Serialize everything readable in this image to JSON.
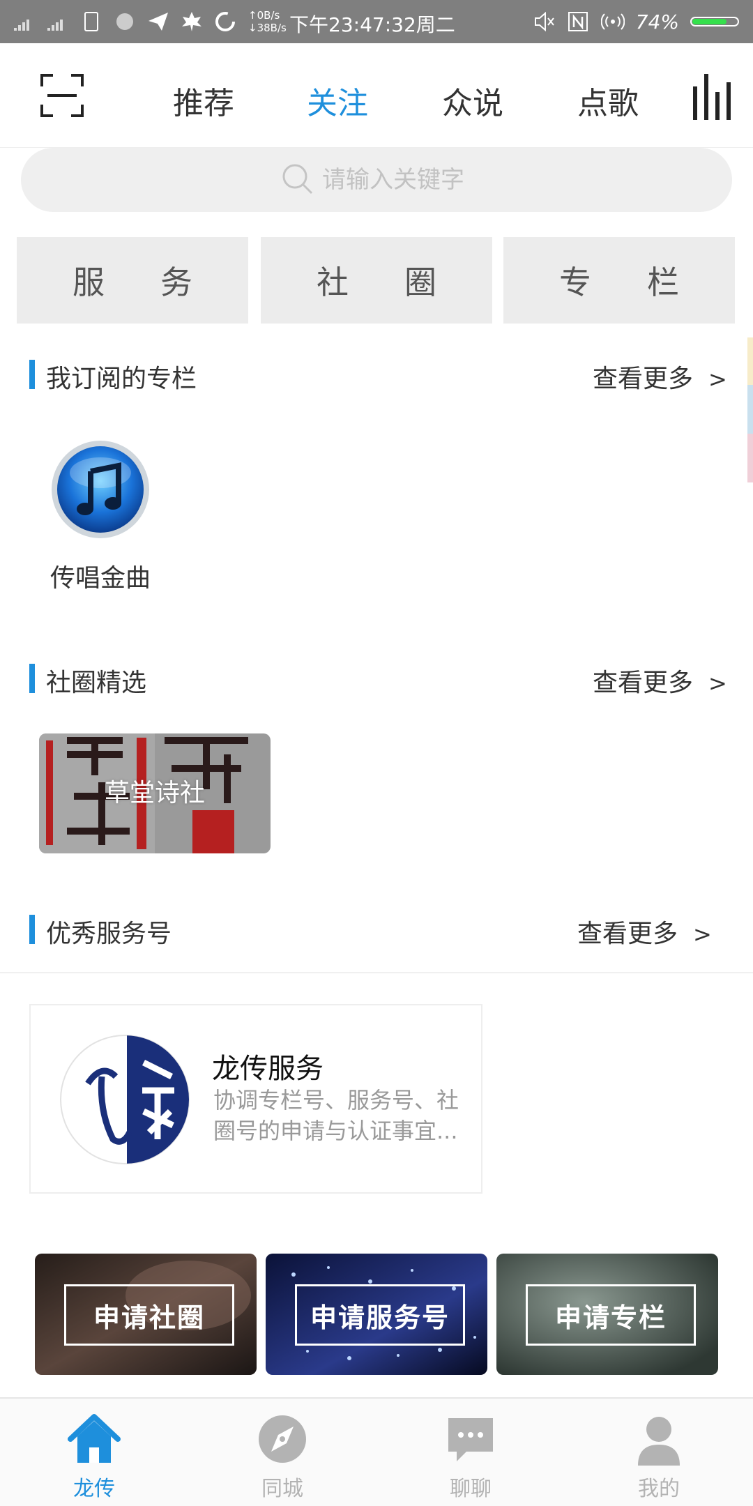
{
  "status_bar": {
    "net_up": "↑0B/s",
    "net_down": "↓38B/s",
    "time": "下午23:47:32周二",
    "battery": "74%",
    "battery_level": 0.74
  },
  "top_nav": {
    "tabs": [
      {
        "label": "推荐",
        "active": false
      },
      {
        "label": "关注",
        "active": true
      },
      {
        "label": "众说",
        "active": false
      },
      {
        "label": "点歌",
        "active": false
      }
    ]
  },
  "search": {
    "placeholder": "请输入关键字"
  },
  "categories": [
    "服务",
    "社圈",
    "专栏"
  ],
  "sections": {
    "subscribed": {
      "title": "我订阅的专栏",
      "more": "查看更多",
      "items": [
        {
          "label": "传唱金曲",
          "icon": "music-note-icon"
        }
      ]
    },
    "circles": {
      "title": "社圈精选",
      "more": "查看更多",
      "items": [
        {
          "label": "草堂诗社"
        }
      ]
    },
    "services": {
      "title": "优秀服务号",
      "more": "查看更多",
      "items": [
        {
          "name": "龙传服务",
          "desc": "协调专栏号、服务号、社圈号的申请与认证事宜..."
        }
      ]
    }
  },
  "apply_buttons": [
    "申请社圈",
    "申请服务号",
    "申请专栏"
  ],
  "bottom_nav": {
    "items": [
      {
        "label": "龙传",
        "icon": "home-icon",
        "active": true
      },
      {
        "label": "同城",
        "icon": "compass-icon",
        "active": false
      },
      {
        "label": "聊聊",
        "icon": "chat-icon",
        "active": false
      },
      {
        "label": "我的",
        "icon": "user-icon",
        "active": false
      }
    ]
  },
  "colors": {
    "accent": "#1e8fdc",
    "inactive": "#b3b3b3"
  }
}
